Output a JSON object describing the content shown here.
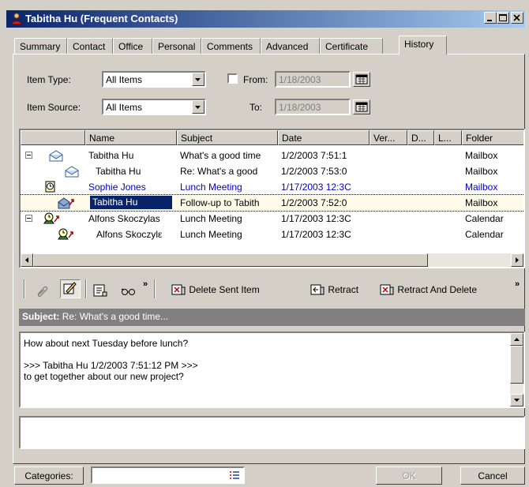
{
  "window": {
    "title": "Tabitha Hu (Frequent Contacts)"
  },
  "tabs": [
    {
      "label": "Summary"
    },
    {
      "label": "Contact"
    },
    {
      "label": "Office"
    },
    {
      "label": "Personal"
    },
    {
      "label": "Comments"
    },
    {
      "label": "Advanced"
    },
    {
      "label": "Certificate"
    },
    {
      "label": "History",
      "active": true
    }
  ],
  "filters": {
    "item_type_label": "Item Type:",
    "item_type_value": "All Items",
    "item_source_label": "Item Source:",
    "item_source_value": "All Items",
    "from_label": "From:",
    "from_value": "1/18/2003",
    "to_label": "To:",
    "to_value": "1/18/2003"
  },
  "list": {
    "columns": [
      "Name",
      "Subject",
      "Date",
      "Ver...",
      "D...",
      "L...",
      "Folder"
    ],
    "rows": [
      {
        "name": "Tabitha Hu",
        "subject": "What's a good time",
        "date": "1/2/2003 7:51:1",
        "folder": "Mailbox",
        "icon": "mail-open-icon"
      },
      {
        "name": "Tabitha Hu",
        "subject": "Re: What's a good",
        "date": "1/2/2003 7:53:0",
        "folder": "Mailbox",
        "icon": "mail-open-icon"
      },
      {
        "name": "Sophie Jones",
        "subject": "Lunch Meeting",
        "date": "1/17/2003 12:3C",
        "folder": "Mailbox",
        "icon": "appointment-icon"
      },
      {
        "name": "Tabitha Hu",
        "subject": "Follow-up to Tabith",
        "date": "1/2/2003 7:52:0",
        "folder": "Mailbox",
        "icon": "mail-sent-icon"
      },
      {
        "name": "Alfons Skoczylas",
        "subject": "Lunch Meeting",
        "date": "1/17/2003 12:3C",
        "folder": "Calendar",
        "icon": "appointment-sent-icon"
      },
      {
        "name": "Alfons Skoczylε",
        "subject": "Lunch Meeting",
        "date": "1/17/2003 12:3C",
        "folder": "Calendar",
        "icon": "appointment-sent-icon"
      }
    ]
  },
  "toolbar": {
    "delete_sent_item": "Delete Sent Item",
    "retract": "Retract",
    "retract_and_delete": "Retract And Delete",
    "more": "»"
  },
  "message": {
    "subject_label": "Subject:",
    "subject_value": "Re: What's a good time...",
    "body": "How about next Tuesday before lunch?\n\n>>> Tabitha Hu 1/2/2003 7:51:12 PM >>>\nto get together about our new project?"
  },
  "footer": {
    "categories_label": "Categories:",
    "ok_label": "OK",
    "cancel_label": "Cancel"
  }
}
